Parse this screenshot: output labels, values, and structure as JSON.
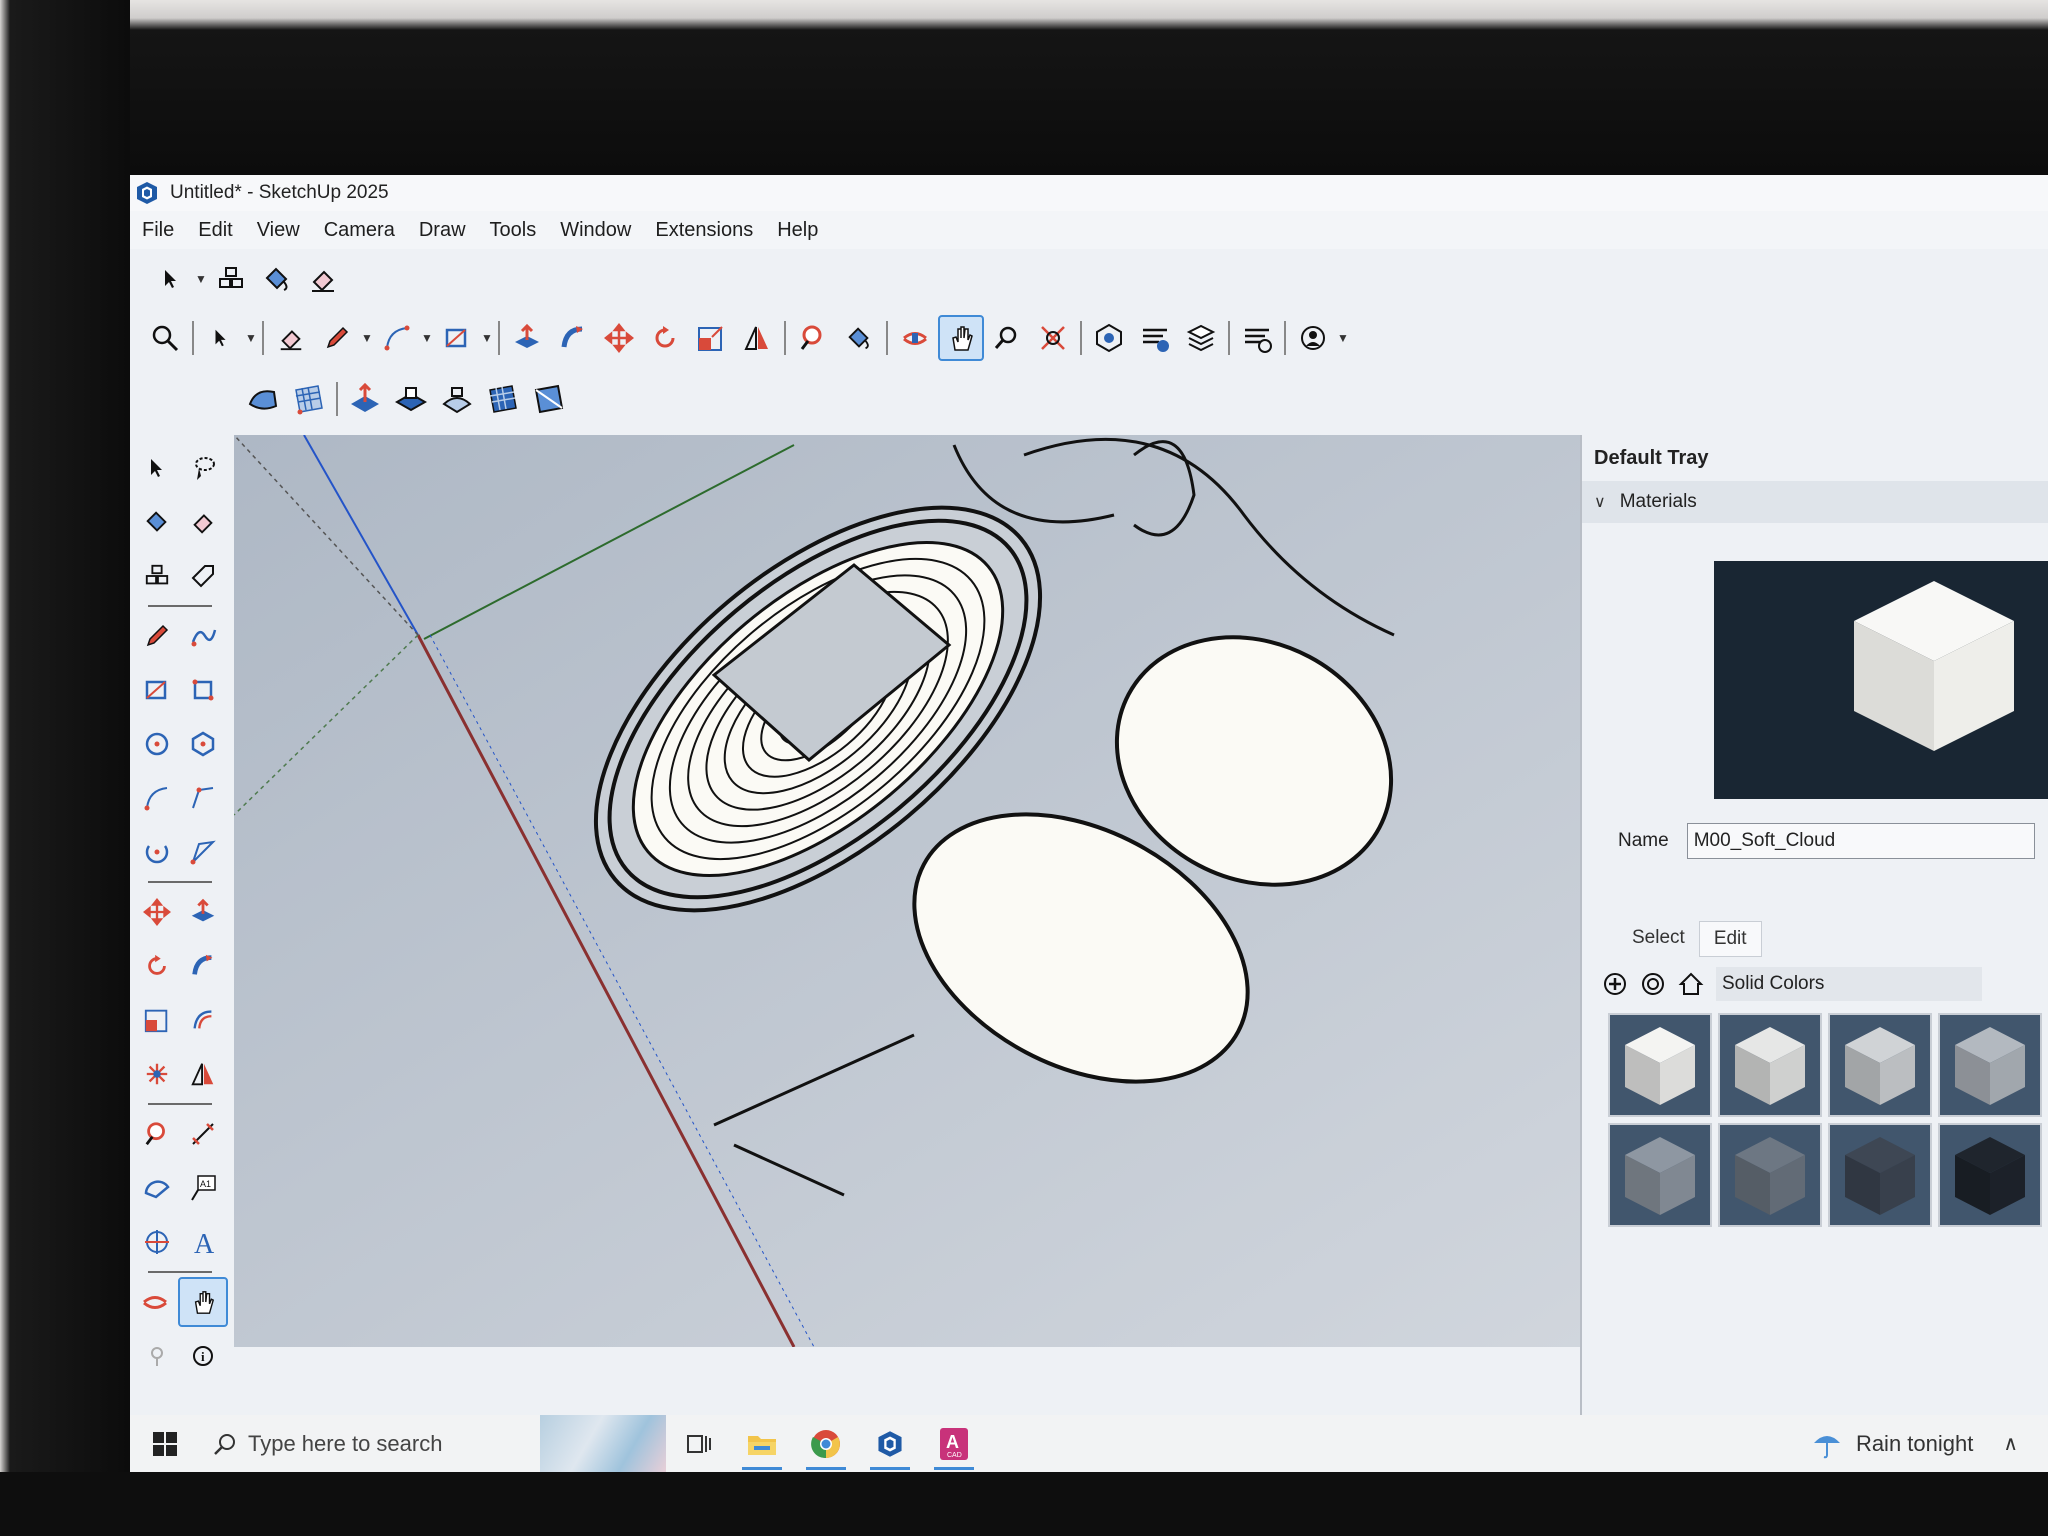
{
  "window": {
    "title": "Untitled* - SketchUp 2025"
  },
  "menu": [
    "File",
    "Edit",
    "View",
    "Camera",
    "Draw",
    "Tools",
    "Window",
    "Extensions",
    "Help"
  ],
  "tray": {
    "title": "Default Tray",
    "panel": "Materials",
    "name_label": "Name",
    "material_name": "M00_Soft_Cloud",
    "tab_select": "Select",
    "tab_edit": "Edit",
    "library": "Solid Colors",
    "swatch_tones": [
      "#f4f4f2",
      "#e6e7e6",
      "#d0d3d6",
      "#b3b9c0",
      "#8e97a2",
      "#6d7783",
      "#3e4754",
      "#1f252d"
    ]
  },
  "taskbar": {
    "search_placeholder": "Type here to search",
    "weather": "Rain tonight"
  },
  "left_toolbar_icons": [
    "select-icon",
    "lasso-icon",
    "paint-bucket-icon",
    "eraser-icon",
    "component-icon",
    "tag-icon",
    "pencil-icon",
    "freehand-icon",
    "rectangle-icon",
    "rotated-rectangle-icon",
    "circle-icon",
    "polygon-icon",
    "arc-icon",
    "pie-icon",
    "two-point-arc-icon",
    "three-point-arc-icon",
    "move-icon",
    "push-pull-icon",
    "rotate-icon",
    "follow-me-icon",
    "scale-icon",
    "offset-icon",
    "tape-measure-icon",
    "protractor-icon",
    "dimension-icon",
    "text-icon",
    "axes-icon",
    "3d-text-icon",
    "section-plane-icon",
    "orbit-icon",
    "walk-icon",
    "info-icon"
  ],
  "colors": {
    "accent": "#3f8ad6",
    "viewport_bg": "#c3cad4",
    "model_fill": "#fbfaf5"
  },
  "lettering": {
    "tool_text_glyph": "A1",
    "text_tool_glyph": "A",
    "app_icon_glyph": "A",
    "app_icon_sub": "CAD",
    "info_glyph": "i"
  }
}
